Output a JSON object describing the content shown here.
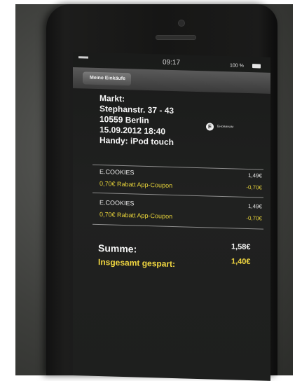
{
  "status_bar": {
    "time": "09:17",
    "battery": "100 %"
  },
  "nav": {
    "back_label": "Meine Einkäufe"
  },
  "receipt": {
    "header_lines": [
      "Markt:",
      "Stephanstr. 37 - 43",
      "10559 Berlin",
      "15.09.2012 18:40",
      "Handy: iPod touch"
    ],
    "store_label": "Бновинам",
    "items": [
      {
        "name": "E.COOKIES",
        "amount": "1,49€"
      },
      {
        "name": "0,70€ Rabatt App-Coupon",
        "amount": "-0,70€"
      },
      {
        "name": "E.COOKIES",
        "amount": "1,49€"
      },
      {
        "name": "0,70€ Rabatt App-Coupon",
        "amount": "-0,70€"
      }
    ],
    "sum_label": "Summe:",
    "sum_value": "1,58€",
    "saved_label": "Insgesamt gespart:",
    "saved_value": "1,40€"
  },
  "colors": {
    "accent_yellow": "#e7d33a",
    "text_white": "#f4f4f4"
  }
}
